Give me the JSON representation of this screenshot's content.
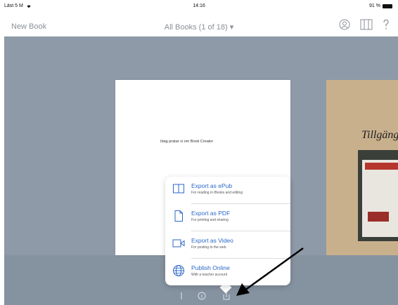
{
  "status": {
    "left": "Läst 5 M",
    "time": "14:16",
    "right": "91 %"
  },
  "nav": {
    "back_label": "New Book",
    "title": "All Books (1 of 18) ▾"
  },
  "book": {
    "text": "Idag pratar vi om Book Creator"
  },
  "book2": {
    "title": "Tillgäng"
  },
  "menu": {
    "items": [
      {
        "title": "Export as ePub",
        "subtitle": "For reading in iBooks and editing",
        "icon": "book-icon"
      },
      {
        "title": "Export as PDF",
        "subtitle": "For printing and sharing",
        "icon": "document-icon"
      },
      {
        "title": "Export as Video",
        "subtitle": "For posting to the web",
        "icon": "video-icon"
      },
      {
        "title": "Publish Online",
        "subtitle": "With a teacher account",
        "icon": "globe-icon"
      }
    ]
  },
  "colors": {
    "accent": "#2b67c7",
    "shelf": "#8e9aa7",
    "nav_text": "#8a8f97"
  }
}
